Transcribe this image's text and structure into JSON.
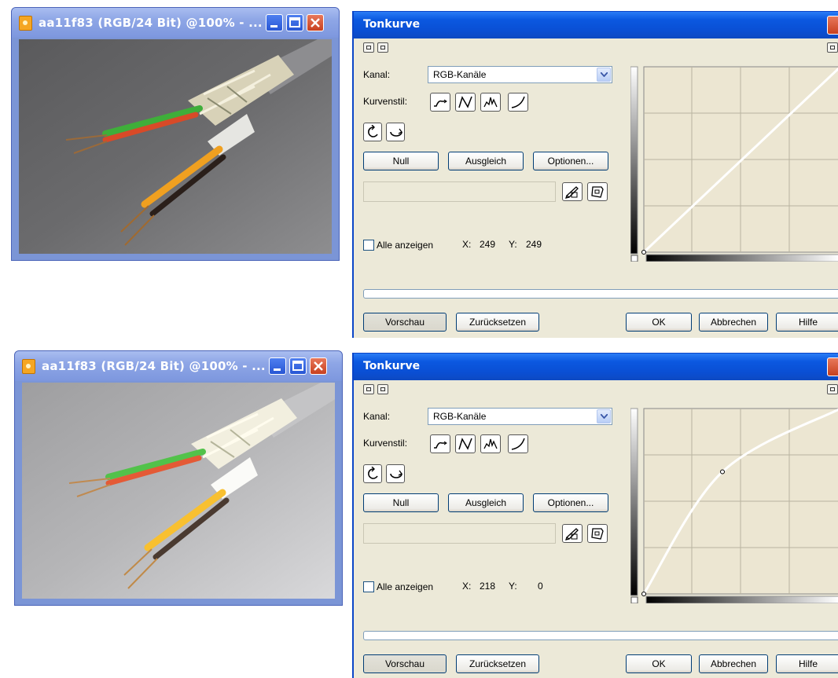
{
  "windows": [
    {
      "title": "aa11f83 (RGB/24 Bit) @100% - ..."
    },
    {
      "title": "aa11f83 (RGB/24 Bit) @100% - ..."
    }
  ],
  "dialogs": [
    {
      "title": "Tonkurve",
      "kanal_label": "Kanal:",
      "kanal_value": "RGB-Kanäle",
      "kurvenstil_label": "Kurvenstil:",
      "null_button": "Null",
      "ausgleich_button": "Ausgleich",
      "optionen_button": "Optionen...",
      "alle_anzeigen": "Alle anzeigen",
      "x_label": "X:",
      "x_value": "249",
      "y_label": "Y:",
      "y_value": "249",
      "vorschau_button": "Vorschau",
      "zuruecksetzen_button": "Zurücksetzen",
      "ok_button": "OK",
      "abbrechen_button": "Abbrechen",
      "hilfe_button": "Hilfe",
      "curve": {
        "points": [
          [
            0,
            0
          ],
          [
            255,
            255
          ]
        ],
        "shape": "linear"
      }
    },
    {
      "title": "Tonkurve",
      "kanal_label": "Kanal:",
      "kanal_value": "RGB-Kanäle",
      "kurvenstil_label": "Kurvenstil:",
      "null_button": "Null",
      "ausgleich_button": "Ausgleich",
      "optionen_button": "Optionen...",
      "alle_anzeigen": "Alle anzeigen",
      "x_label": "X:",
      "x_value": "218",
      "y_label": "Y:",
      "y_value": "0",
      "vorschau_button": "Vorschau",
      "zuruecksetzen_button": "Zurücksetzen",
      "ok_button": "OK",
      "abbrechen_button": "Abbrechen",
      "hilfe_button": "Hilfe",
      "curve": {
        "points": [
          [
            0,
            0
          ],
          [
            102,
            168
          ],
          [
            255,
            255
          ]
        ],
        "shape": "smooth"
      }
    }
  ],
  "colors": {
    "dialog_bg": "#ece9d8",
    "titlebar": "#0a4fd4",
    "image_window": "#7b95d6",
    "curve_grid_bg": "#ece6d2",
    "curve_line": "#ffffff"
  }
}
